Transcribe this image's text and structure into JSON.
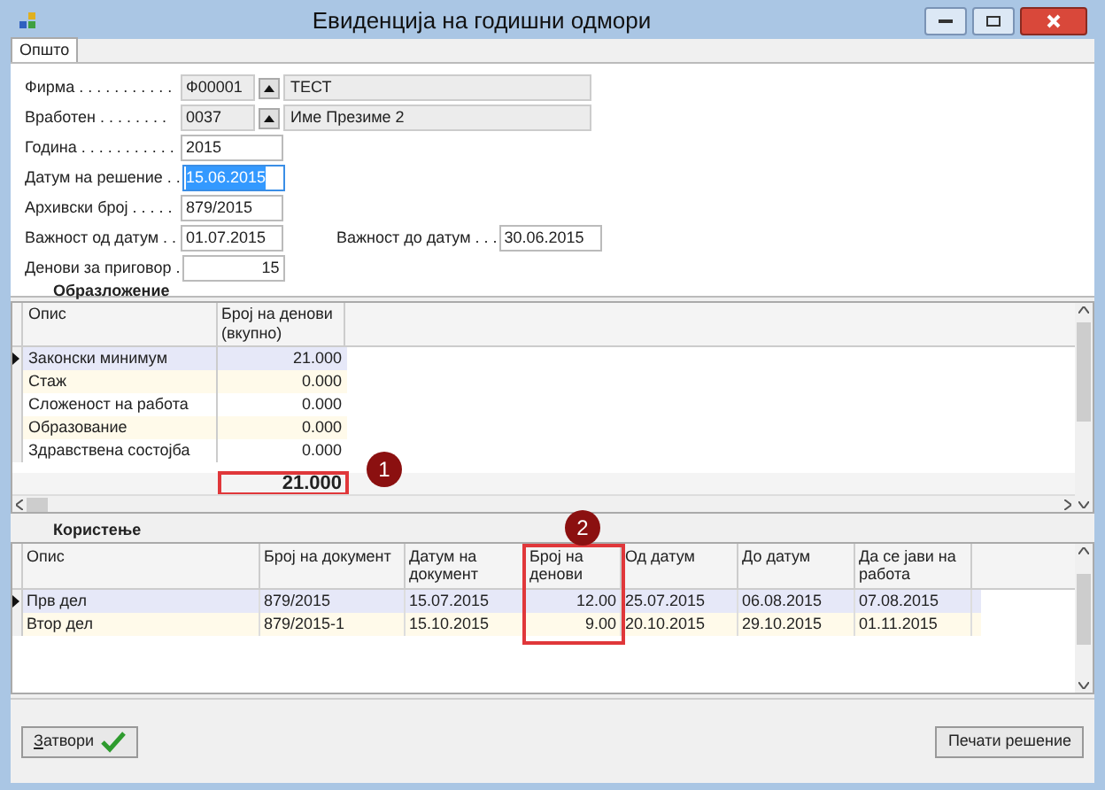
{
  "window": {
    "title": "Евиденција на годишни одмори"
  },
  "tabs": [
    {
      "label": "Општо",
      "selected": true
    }
  ],
  "form": {
    "rows": [
      [
        {
          "kind": "lookup",
          "label": "Фирма . . . . . . . . . . .",
          "value": "Ф00001",
          "name": "ТЕСТ"
        }
      ],
      [
        {
          "kind": "lookup",
          "label": "Вработен . . . . . . . .",
          "value": "0037",
          "name": "Име Презиме 2"
        }
      ],
      [
        {
          "kind": "text",
          "label": "Година . . . . . . . . . . .",
          "value": "2015",
          "highlighted": false
        }
      ],
      [
        {
          "kind": "text",
          "label": "Датум на решение . .",
          "value": "15.06.2015",
          "highlighted": true
        }
      ],
      [
        {
          "kind": "text",
          "label": "Архивски број . . . . .",
          "value": "879/2015",
          "highlighted": false
        }
      ],
      [
        {
          "kind": "text",
          "label": "Важност од датум . .",
          "value": "01.07.2015",
          "highlighted": false
        },
        {
          "kind": "text",
          "label": "Важност до датум . . .",
          "value": "30.06.2015",
          "highlighted": false
        }
      ],
      [
        {
          "kind": "number",
          "label": "Денови за приговор .",
          "value": "15",
          "highlighted": false
        }
      ]
    ]
  },
  "justification": {
    "title": "Образложение",
    "columns": [
      "Опис",
      "Број на денови (вкупно)"
    ],
    "rows": [
      {
        "description": "Законски минимум",
        "days": "21.000",
        "selected": true
      },
      {
        "description": "Стаж",
        "days": "0.000",
        "selected": false
      },
      {
        "description": "Сложеност на работа",
        "days": "0.000",
        "selected": false
      },
      {
        "description": "Образование",
        "days": "0.000",
        "selected": false
      },
      {
        "description": "Здравствена состојба",
        "days": "0.000",
        "selected": false
      }
    ],
    "total": "21.000",
    "callout": "1"
  },
  "usage": {
    "title": "Користење",
    "columns": [
      "Опис",
      "Број на документ",
      "Датум на документ",
      "Број на денови",
      "Од датум",
      "До датум",
      "Да се јави на работа"
    ],
    "rows": [
      {
        "cells": [
          "Прв дел",
          "879/2015",
          "15.07.2015",
          "12.00",
          "25.07.2015",
          "06.08.2015",
          "07.08.2015"
        ],
        "selected": true
      },
      {
        "cells": [
          "Втор дел",
          "879/2015-1",
          "15.10.2015",
          "9.00",
          "20.10.2015",
          "29.10.2015",
          "01.11.2015"
        ],
        "selected": false
      }
    ],
    "callout": "2"
  },
  "buttons": {
    "close": "Затвори",
    "print": "Печати решение"
  }
}
